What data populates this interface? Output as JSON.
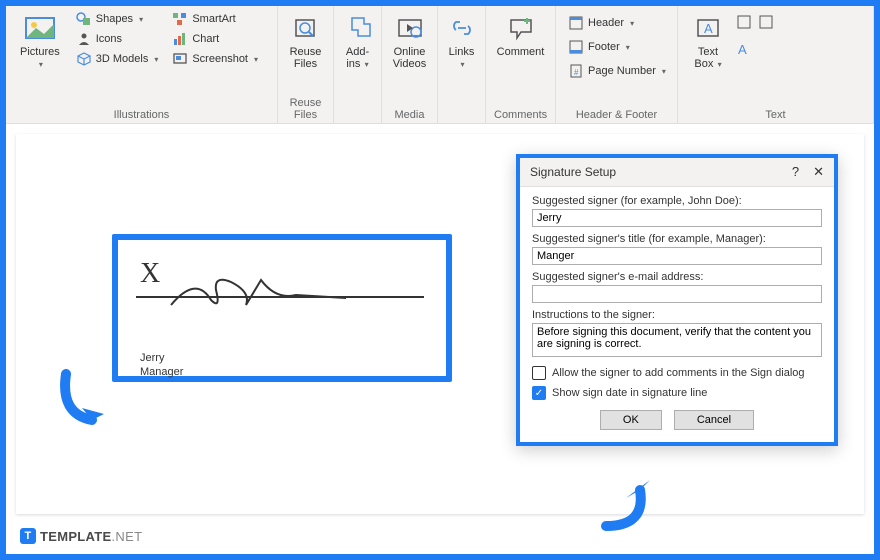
{
  "ribbon": {
    "illustrations": {
      "label": "Illustrations",
      "pictures": "Pictures",
      "shapes": "Shapes",
      "icons": "Icons",
      "models3d": "3D Models",
      "smartart": "SmartArt",
      "chart": "Chart",
      "screenshot": "Screenshot"
    },
    "reuse": {
      "label": "Reuse Files",
      "btn": "Reuse\nFiles"
    },
    "addins": {
      "label": " ",
      "btn": "Add-\nins"
    },
    "media": {
      "label": "Media",
      "btn": "Online\nVideos"
    },
    "links": {
      "label": " ",
      "btn": "Links"
    },
    "comments": {
      "label": "Comments",
      "btn": "Comment"
    },
    "hf": {
      "label": "Header & Footer",
      "header": "Header",
      "footer": "Footer",
      "pagenum": "Page Number"
    },
    "text": {
      "label": "Text",
      "textbox": "Text\nBox"
    }
  },
  "signature": {
    "name": "Jerry",
    "title": "Manager"
  },
  "dialog": {
    "title": "Signature Setup",
    "labels": {
      "signer": "Suggested signer (for example, John Doe):",
      "role": "Suggested signer's title (for example, Manager):",
      "email": "Suggested signer's e-mail address:",
      "instr": "Instructions to the signer:"
    },
    "values": {
      "signer": "Jerry",
      "role": "Manger",
      "email": "",
      "instr": "Before signing this document, verify that the content you are signing is correct."
    },
    "cb1": "Allow the signer to add comments in the Sign dialog",
    "cb2": "Show sign date in signature line",
    "ok": "OK",
    "cancel": "Cancel"
  },
  "footer": {
    "brand": "TEMPLATE",
    "suffix": ".NET",
    "logo": "T"
  }
}
